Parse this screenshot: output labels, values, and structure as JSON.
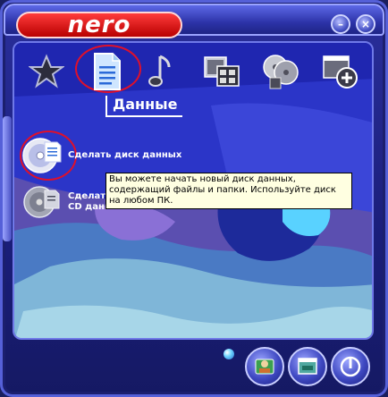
{
  "window": {
    "logo": "nero"
  },
  "tabs": [
    {
      "id": "favorites",
      "icon": "star-icon"
    },
    {
      "id": "data",
      "icon": "document-icon",
      "selected": true
    },
    {
      "id": "audio",
      "icon": "music-note-icon"
    },
    {
      "id": "video",
      "icon": "film-icon"
    },
    {
      "id": "copy",
      "icon": "disc-copy-icon"
    },
    {
      "id": "extras",
      "icon": "add-window-icon"
    }
  ],
  "section": {
    "title": "Данные"
  },
  "tasks": [
    {
      "label": "Сделать диск данных",
      "icon": "data-disc-icon"
    },
    {
      "label": "Сделать\nCD данных",
      "icon": "cd-data-icon"
    }
  ],
  "tooltip": {
    "text": "Вы можете начать новый диск данных, содержащий файлы и папки. Используйте диск на любом ПК."
  },
  "colors": {
    "frame": "#2a2f9c",
    "accent": "#e0102a",
    "tooltip_bg": "#ffffe1",
    "logo_red": "#d40000"
  }
}
